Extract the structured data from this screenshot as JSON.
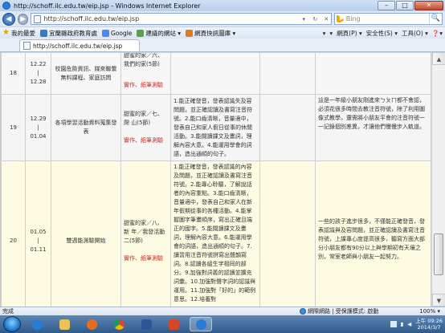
{
  "window": {
    "title": "http://schoff.ilc.edu.tw/eip.jsp - Windows Internet Explorer",
    "min": "–",
    "max": "□",
    "close": "✕"
  },
  "address": {
    "url": "http://schoff.ilc.edu.tw/eip.jsp",
    "refresh": "↻",
    "stop": "✕",
    "dropdown": "▾"
  },
  "search": {
    "placeholder": "Bing",
    "button": "🔍"
  },
  "favorites": {
    "label": "我的最愛",
    "items": [
      "宜蘭縣政府教育處",
      "Google",
      "建議的網站 ▾",
      "網頁快訊圖庫 ▾"
    ],
    "tools": [
      "▾",
      "▾",
      "網頁(P) ▾",
      "安全性(S) ▾",
      "工具(O) ▾",
      "❓▾"
    ]
  },
  "tab": {
    "label": "http://schoff.ilc.edu.tw/eip.jsp"
  },
  "rows": [
    {
      "num": "18",
      "date_from": "12.22",
      "date_to": "12.28",
      "topic": "校園危險資訊、媒來聯繫 無料課程、家庭訪問",
      "unit": "甜蜜的家／六、我們的家(5節)",
      "tag": "實作、紙筆測驗",
      "goal": "",
      "indicators": "",
      "note": ""
    },
    {
      "num": "19",
      "date_from": "12.29",
      "date_to": "01.04",
      "topic": "各項學習活動資料蒐集發表",
      "unit": "甜蜜的家／七、爬 山(5節)",
      "tag": "實作、紙筆測驗",
      "goal": "1.能正確發音，發表認識失及容問題，並正確認讀及書寫注音符號。2.能口齒清晰，音量適中，發表自己和家人假日從事的休閒活動。3.能閱讀課文及畫詞，理解內容大意。4.能運用學會的詞語，造出通順的句子。",
      "indicators": "",
      "note": "這是一年級小朋友剛進來ㄅㄆㄇ都不會認，必須花很多時間去教注音符號，除了利用圖像式教學，還需將小朋友平會的注音符號一一記錄個別差異，才讓他們慢慢步入軌道。"
    },
    {
      "num": "20",
      "date_from": "01.05",
      "date_to": "01.11",
      "topic": "雙週能測驗開始",
      "unit": "甜蜜的家／八、新 年／我發活動二(5節)",
      "tag": "實作、紙筆測驗",
      "goal": "1.能正確發音，發表認識的內容及問題，並正確認讀及書寫注音符號。2.能專心聆聽，了解說話者的內容重點。3.能口齒清晰，音量適中，發表自己和家人在新年假期從事的各種活動。4.能掌握圖字筆畫順序，寫出正確且端正的國字。5.能閱讀課文及畫詞，理解內容大意。6.能運用學會的詞語，造出通順的句子。7.讀習用注音符號拼寫出聲韻寫詞。8.認讀各組生字相同的部分。9.加強對詞義的認讀並擴充詞彙。10.加強對聲字詞的認識與運用。11.加強對「好的」的範例意思。12.培養對",
      "indicators": "",
      "note": "一些的孩子進步很多，不僅能正確發音，發表認識與及容問題，並正確認讀及書寫注音符號，上課專心度提高很多，聽寫方面大部分小朋友都有90分以上與學期初有天壤之別，常室老師與小朋友一起努力。"
    }
  ],
  "status": {
    "done": "完成",
    "zone": "網際網路 | 受保護模式: 啟動",
    "zoom": "100% ▾"
  },
  "taskbar": {
    "clock_time": "上午 09:26",
    "clock_date": "2014/3/7"
  }
}
